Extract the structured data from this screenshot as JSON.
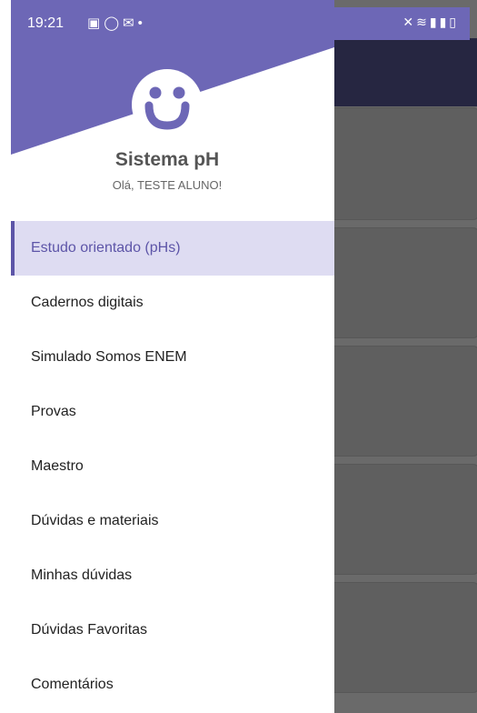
{
  "status_bar": {
    "time": "19:21",
    "left_icons": [
      "gallery-icon",
      "whatsapp-icon",
      "gmail-icon",
      "dot-icon"
    ],
    "right_icons": [
      "mute-icon",
      "wifi-icon",
      "signal-icon",
      "signal-icon",
      "battery-icon"
    ]
  },
  "drawer": {
    "app_name": "Sistema pH",
    "greeting": "Olá, TESTE ALUNO!",
    "menu": [
      {
        "label": "Estudo orientado (pHs)",
        "active": true
      },
      {
        "label": "Cadernos digitais",
        "active": false
      },
      {
        "label": "Simulado Somos ENEM",
        "active": false
      },
      {
        "label": "Provas",
        "active": false
      },
      {
        "label": "Maestro",
        "active": false
      },
      {
        "label": "Dúvidas e materiais",
        "active": false
      },
      {
        "label": "Minhas dúvidas",
        "active": false
      },
      {
        "label": "Dúvidas Favoritas",
        "active": false
      },
      {
        "label": "Comentários",
        "active": false
      }
    ]
  },
  "colors": {
    "brand": "#6d67b6",
    "active_bg": "#dedcf2",
    "active_text": "#5d55a8",
    "appbar": "#262641"
  }
}
